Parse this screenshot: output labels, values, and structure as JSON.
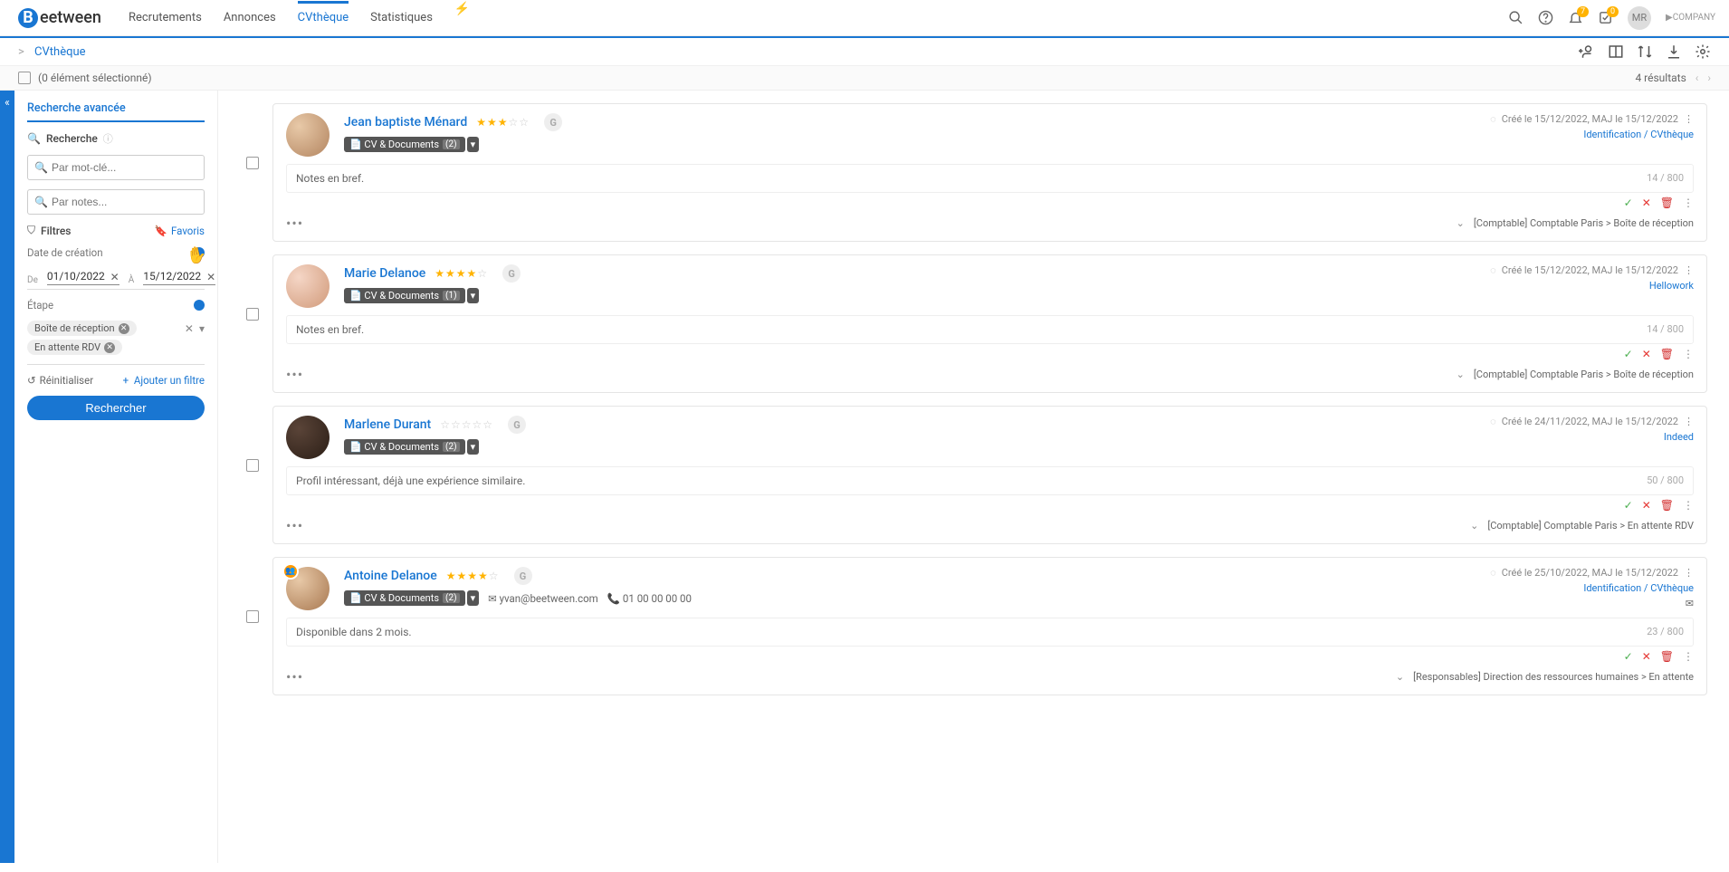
{
  "brand": {
    "letter": "B",
    "rest": "eetween"
  },
  "nav": {
    "items": [
      "Recrutements",
      "Annonces",
      "CVthèque",
      "Statistiques"
    ],
    "active_index": 2,
    "notif_badge": "7",
    "task_badge": "0",
    "user_initials": "MR",
    "company_label": "COMPANY"
  },
  "breadcrumb": {
    "sep": ">",
    "page": "CVthèque"
  },
  "selection": {
    "label": "(0 élément sélectionné)",
    "results": "4 résultats"
  },
  "sidebar": {
    "tab": "Recherche avancée",
    "search_section": "Recherche",
    "keyword_placeholder": "Par mot-clé...",
    "notes_placeholder": "Par notes...",
    "filters_section": "Filtres",
    "favoris": "Favoris",
    "date_label": "Date de création",
    "date_from_lbl": "De",
    "date_from": "01/10/2022",
    "date_to_lbl": "À",
    "date_to": "15/12/2022",
    "stage_label": "Étape",
    "chips": [
      "Boîte de réception",
      "En attente RDV"
    ],
    "reset": "Réinitialiser",
    "add_filter": "Ajouter un filtre",
    "search_btn": "Rechercher"
  },
  "candidates": [
    {
      "name": "Jean baptiste Ménard",
      "rating": 3,
      "docs_label": "CV & Documents",
      "docs_count": "(2)",
      "created": "Créé le 15/12/2022, MAJ le 15/12/2022",
      "source": "Identification / CVthèque",
      "notes": "Notes en bref.",
      "char_count": "14 / 800",
      "pipeline": "[Comptable] Comptable Paris > Boîte de réception",
      "avatar_class": "a1"
    },
    {
      "name": "Marie Delanoe",
      "rating": 4,
      "docs_label": "CV & Documents",
      "docs_count": "(1)",
      "created": "Créé le 15/12/2022, MAJ le 15/12/2022",
      "source": "Hellowork",
      "notes": "Notes en bref.",
      "char_count": "14 / 800",
      "pipeline": "[Comptable] Comptable Paris > Boîte de réception",
      "avatar_class": "a2"
    },
    {
      "name": "Marlene Durant",
      "rating": 0,
      "docs_label": "CV & Documents",
      "docs_count": "(2)",
      "created": "Créé le 24/11/2022, MAJ le 15/12/2022",
      "source": "Indeed",
      "notes": "Profil intéressant, déjà une expérience similaire.",
      "char_count": "50 / 800",
      "pipeline": "[Comptable] Comptable Paris > En attente RDV",
      "avatar_class": "a3"
    },
    {
      "name": "Antoine Delanoe",
      "rating": 4,
      "docs_label": "CV & Documents",
      "docs_count": "(2)",
      "email": "yvan@beetween.com",
      "phone": "01 00 00 00 00",
      "created": "Créé le 25/10/2022, MAJ le 15/12/2022",
      "source": "Identification / CVthèque",
      "notes": "Disponible dans 2 mois.",
      "char_count": "23 / 800",
      "pipeline": "[Responsables] Direction des ressources humaines > En attente",
      "avatar_class": "a4",
      "has_badge": true,
      "has_mail_icon": true
    }
  ]
}
